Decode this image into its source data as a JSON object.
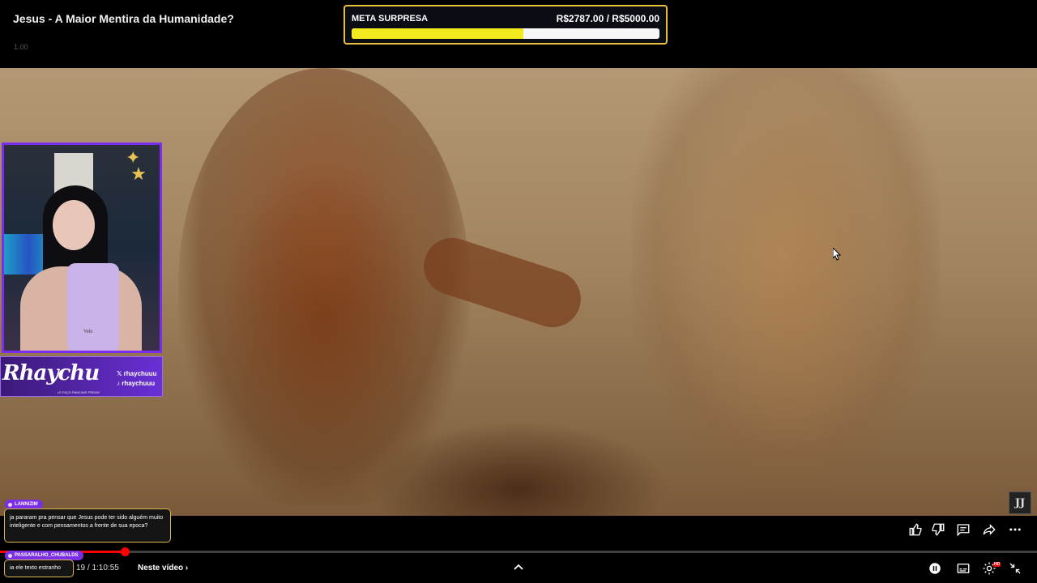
{
  "video": {
    "title": "Jesus - A Maior Mentira da Humanidade?",
    "speed": "1.00"
  },
  "goal": {
    "title": "META SURPRESA",
    "amount": "R$2787.00 / R$5000.00",
    "progress": 0.5574,
    "fill_color": "#f2ea1e",
    "border_color": "#e6c03a"
  },
  "webcam": {
    "cup_label": "Yelo"
  },
  "brand": {
    "name": "Rhaychu",
    "subline": "LE FAÇO PANCAKE FRIDAY",
    "handle_x": "rhaychuuu",
    "handle_tiktok": "rhaychuuu",
    "accent": "#7b2cf0"
  },
  "watermark": {
    "text": "JJ"
  },
  "chat": [
    {
      "user": "LANNIZIM",
      "text": "ja pararam pra pensar que Jesus pode ter sido alguém muito inteligente e com pensamentos a frente de sua epoca?"
    },
    {
      "user": "PASSARALHO_CHUBALDS",
      "text": "ia ele texto estranho"
    }
  ],
  "player": {
    "time": "19 / 1:10:55",
    "next_chapter": "Neste vídeo",
    "played_fraction": 0.12,
    "progress_color": "#ff0000"
  },
  "icons": [
    "like-icon",
    "dislike-icon",
    "comments-icon",
    "share-icon",
    "more-icon",
    "chevron-up-icon",
    "pause-icon",
    "captions-icon",
    "settings-icon",
    "exit-fullscreen-icon"
  ]
}
